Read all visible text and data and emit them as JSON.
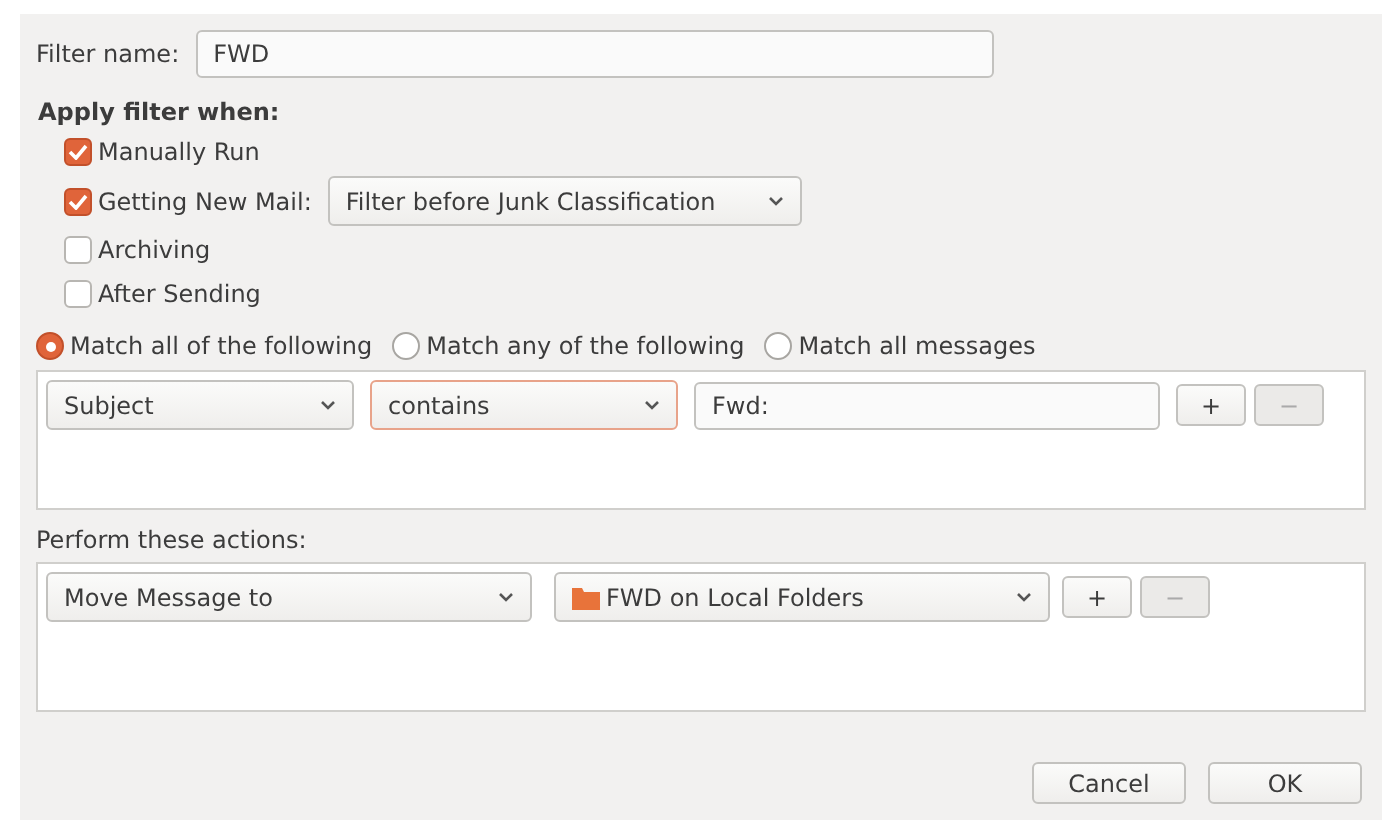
{
  "filter_name": {
    "label": "Filter name:",
    "value": "FWD"
  },
  "apply_when": {
    "heading": "Apply filter when:",
    "options": [
      {
        "label": "Manually Run",
        "checked": true
      },
      {
        "label": "Getting New Mail:",
        "checked": true,
        "dropdown": "Filter before Junk Classification"
      },
      {
        "label": "Archiving",
        "checked": false
      },
      {
        "label": "After Sending",
        "checked": false
      }
    ]
  },
  "match": [
    {
      "label": "Match all of the following",
      "selected": true
    },
    {
      "label": "Match any of the following",
      "selected": false
    },
    {
      "label": "Match all messages",
      "selected": false
    }
  ],
  "conditions": [
    {
      "field": "Subject",
      "operator": "contains",
      "value": "Fwd:",
      "add": "+",
      "remove": "−",
      "remove_disabled": true
    }
  ],
  "actions_heading": "Perform these actions:",
  "actions": [
    {
      "action": "Move Message to",
      "target": "FWD on Local Folders",
      "add": "+",
      "remove": "−",
      "remove_disabled": true
    }
  ],
  "buttons": [
    "Cancel",
    "OK"
  ]
}
